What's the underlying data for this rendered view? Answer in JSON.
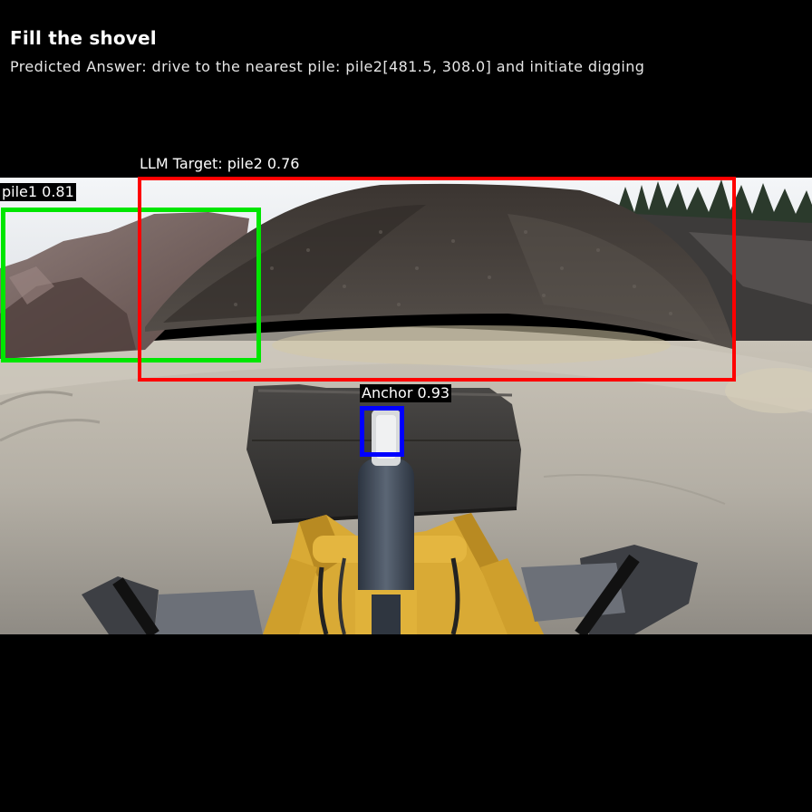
{
  "header": {
    "title": "Fill the shovel",
    "predicted_answer": "Predicted Answer: drive to the nearest pile: pile2[481.5, 308.0] and initiate digging"
  },
  "detections": [
    {
      "label": "pile1 0.81",
      "color": "#00e600"
    },
    {
      "label": "LLM Target: pile2 0.76",
      "color": "#ff0000"
    },
    {
      "label": "Anchor 0.93",
      "color": "#0000ff"
    }
  ],
  "colors": {
    "background": "#000000",
    "sky": "#eef1f4",
    "ground": "#b9b4aa",
    "pile_dark": "#4a4440",
    "pile_brown": "#7a6660",
    "loader_yellow": "#e0b23a",
    "bucket": "#3a3836"
  }
}
